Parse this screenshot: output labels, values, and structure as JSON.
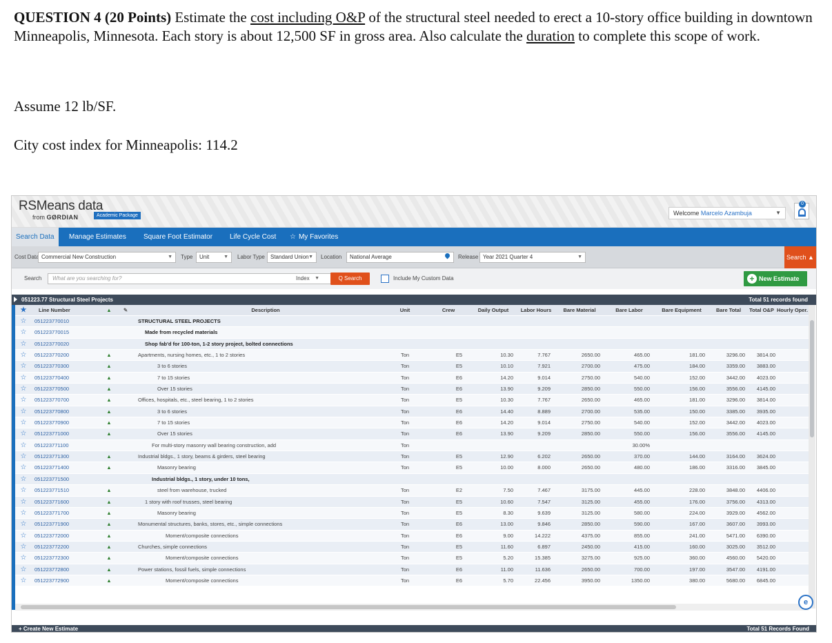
{
  "question": {
    "heading": "QUESTION 4 (20 Points)",
    "t1": " Estimate the ",
    "u1": "cost including O&P",
    "t2": " of the structural steel needed to erect a 10-story office building in downtown Minneapolis, Minnesota. Each story is about 12,500 SF in gross area. Also calculate the ",
    "u2": "duration",
    "t3": " to complete this scope of work.",
    "assume": "Assume 12 lb/SF.",
    "city_index": "City cost index for Minneapolis: 114.2"
  },
  "app": {
    "logo": "RSMeans data",
    "logo_from": "from",
    "logo_brand": "GØRDIAN",
    "package_badge": "Academic Package",
    "welcome_prefix": "Welcome ",
    "user": "Marcelo Azambuja",
    "bell_count": "0",
    "nav": [
      "Search Data",
      "Manage Estimates",
      "Square Foot Estimator",
      "Life Cycle Cost",
      "My Favorites"
    ],
    "filters": {
      "cost_data_label": "Cost Data",
      "cost_data_value": "Commercial New Construction",
      "type_label": "Type",
      "type_value": "Unit",
      "labor_type_label": "Labor Type",
      "labor_type_value": "Standard Union",
      "location_label": "Location",
      "location_value": "National Average",
      "release_label": "Release",
      "release_value": "Year 2021 Quarter 4",
      "search_toggle": "Search ▲"
    },
    "search": {
      "label": "Search",
      "placeholder": "What are you searching for?",
      "index_label": "Index",
      "button": "Q Search",
      "custom_data_label": "Include My Custom Data",
      "new_estimate": "New Estimate"
    },
    "group": {
      "title": "051223.77 Structural Steel Projects",
      "count": "Total 51 records found"
    },
    "columns": {
      "line": "Line Number",
      "desc": "Description",
      "unit": "Unit",
      "crew": "Crew",
      "daily_output": "Daily Output",
      "labor_hours": "Labor Hours",
      "bare_material": "Bare Material",
      "bare_labor": "Bare Labor",
      "bare_equipment": "Bare Equipment",
      "bare_total": "Bare Total",
      "total_op": "Total O&P",
      "hourly": "Hourly Oper. Co"
    },
    "footer": {
      "create": "+ Create New Estimate",
      "count": "Total 51 Records Found"
    }
  },
  "rows": [
    {
      "line": "051223770010",
      "desc": "STRUCTURAL STEEL PROJECTS",
      "bold": true,
      "indent": 0,
      "unit": "",
      "crew": "",
      "out": "",
      "lh": "",
      "bm": "",
      "bl": "",
      "be": "",
      "bt": "",
      "top": ""
    },
    {
      "line": "051223770015",
      "desc": "Made from recycled materials",
      "bold": true,
      "indent": 1,
      "unit": "",
      "crew": "",
      "out": "",
      "lh": "",
      "bm": "",
      "bl": "",
      "be": "",
      "bt": "",
      "top": ""
    },
    {
      "line": "051223770020",
      "desc": "Shop fab'd for 100-ton, 1-2 story project, bolted connections",
      "bold": true,
      "indent": 1,
      "unit": "",
      "crew": "",
      "out": "",
      "lh": "",
      "bm": "",
      "bl": "",
      "be": "",
      "bt": "",
      "top": ""
    },
    {
      "line": "051223770200",
      "desc": "Apartments, nursing homes, etc., 1 to 2 stories",
      "indent": 0,
      "unit": "Ton",
      "crew": "E5",
      "out": "10.30",
      "lh": "7.767",
      "bm": "2650.00",
      "bl": "465.00",
      "be": "181.00",
      "bt": "3296.00",
      "top": "3814.00",
      "ico": true
    },
    {
      "line": "051223770300",
      "desc": "3 to 6 stories",
      "indent": 3,
      "unit": "Ton",
      "crew": "E5",
      "out": "10.10",
      "lh": "7.921",
      "bm": "2700.00",
      "bl": "475.00",
      "be": "184.00",
      "bt": "3359.00",
      "top": "3883.00",
      "ico": true
    },
    {
      "line": "051223770400",
      "desc": "7 to 15 stories",
      "indent": 3,
      "unit": "Ton",
      "crew": "E6",
      "out": "14.20",
      "lh": "9.014",
      "bm": "2750.00",
      "bl": "540.00",
      "be": "152.00",
      "bt": "3442.00",
      "top": "4023.00",
      "ico": true
    },
    {
      "line": "051223770500",
      "desc": "Over 15 stories",
      "indent": 3,
      "unit": "Ton",
      "crew": "E6",
      "out": "13.90",
      "lh": "9.209",
      "bm": "2850.00",
      "bl": "550.00",
      "be": "156.00",
      "bt": "3556.00",
      "top": "4145.00",
      "ico": true
    },
    {
      "line": "051223770700",
      "desc": "Offices, hospitals, etc., steel bearing, 1 to 2 stories",
      "indent": 0,
      "unit": "Ton",
      "crew": "E5",
      "out": "10.30",
      "lh": "7.767",
      "bm": "2650.00",
      "bl": "465.00",
      "be": "181.00",
      "bt": "3296.00",
      "top": "3814.00",
      "ico": true
    },
    {
      "line": "051223770800",
      "desc": "3 to 6 stories",
      "indent": 3,
      "unit": "Ton",
      "crew": "E6",
      "out": "14.40",
      "lh": "8.889",
      "bm": "2700.00",
      "bl": "535.00",
      "be": "150.00",
      "bt": "3385.00",
      "top": "3935.00",
      "ico": true
    },
    {
      "line": "051223770900",
      "desc": "7 to 15 stories",
      "indent": 3,
      "unit": "Ton",
      "crew": "E6",
      "out": "14.20",
      "lh": "9.014",
      "bm": "2750.00",
      "bl": "540.00",
      "be": "152.00",
      "bt": "3442.00",
      "top": "4023.00",
      "ico": true
    },
    {
      "line": "051223771000",
      "desc": "Over 15 stories",
      "indent": 3,
      "unit": "Ton",
      "crew": "E6",
      "out": "13.90",
      "lh": "9.209",
      "bm": "2850.00",
      "bl": "550.00",
      "be": "156.00",
      "bt": "3556.00",
      "top": "4145.00",
      "ico": true
    },
    {
      "line": "051223771100",
      "desc": "For multi-story masonry wall bearing construction, add",
      "indent": 2,
      "unit": "Ton",
      "crew": "",
      "out": "",
      "lh": "",
      "bm": "",
      "bl": "30.00%",
      "be": "",
      "bt": "",
      "top": ""
    },
    {
      "line": "051223771300",
      "desc": "Industrial bldgs., 1 story, beams & girders, steel bearing",
      "indent": 0,
      "unit": "Ton",
      "crew": "E5",
      "out": "12.90",
      "lh": "6.202",
      "bm": "2650.00",
      "bl": "370.00",
      "be": "144.00",
      "bt": "3164.00",
      "top": "3624.00",
      "ico": true
    },
    {
      "line": "051223771400",
      "desc": "Masonry bearing",
      "indent": 3,
      "unit": "Ton",
      "crew": "E5",
      "out": "10.00",
      "lh": "8.000",
      "bm": "2650.00",
      "bl": "480.00",
      "be": "186.00",
      "bt": "3316.00",
      "top": "3845.00",
      "ico": true
    },
    {
      "line": "051223771500",
      "desc": "Industrial bldgs., 1 story, under 10 tons,",
      "bold": true,
      "indent": 2,
      "unit": "",
      "crew": "",
      "out": "",
      "lh": "",
      "bm": "",
      "bl": "",
      "be": "",
      "bt": "",
      "top": ""
    },
    {
      "line": "051223771510",
      "desc": "steel from warehouse, trucked",
      "indent": 3,
      "unit": "Ton",
      "crew": "E2",
      "out": "7.50",
      "lh": "7.467",
      "bm": "3175.00",
      "bl": "445.00",
      "be": "228.00",
      "bt": "3848.00",
      "top": "4406.00",
      "ico": true
    },
    {
      "line": "051223771600",
      "desc": "1 story with roof trusses, steel bearing",
      "indent": 1,
      "unit": "Ton",
      "crew": "E5",
      "out": "10.60",
      "lh": "7.547",
      "bm": "3125.00",
      "bl": "455.00",
      "be": "176.00",
      "bt": "3756.00",
      "top": "4313.00",
      "ico": true
    },
    {
      "line": "051223771700",
      "desc": "Masonry bearing",
      "indent": 3,
      "unit": "Ton",
      "crew": "E5",
      "out": "8.30",
      "lh": "9.639",
      "bm": "3125.00",
      "bl": "580.00",
      "be": "224.00",
      "bt": "3929.00",
      "top": "4562.00",
      "ico": true
    },
    {
      "line": "051223771900",
      "desc": "Monumental structures, banks, stores, etc., simple connections",
      "indent": 0,
      "unit": "Ton",
      "crew": "E6",
      "out": "13.00",
      "lh": "9.846",
      "bm": "2850.00",
      "bl": "590.00",
      "be": "167.00",
      "bt": "3607.00",
      "top": "3993.00",
      "ico": true
    },
    {
      "line": "051223772000",
      "desc": "Moment/composite connections",
      "indent": 4,
      "unit": "Ton",
      "crew": "E6",
      "out": "9.00",
      "lh": "14.222",
      "bm": "4375.00",
      "bl": "855.00",
      "be": "241.00",
      "bt": "5471.00",
      "top": "6390.00",
      "ico": true
    },
    {
      "line": "051223772200",
      "desc": "Churches, simple connections",
      "indent": 0,
      "unit": "Ton",
      "crew": "E5",
      "out": "11.60",
      "lh": "6.897",
      "bm": "2450.00",
      "bl": "415.00",
      "be": "160.00",
      "bt": "3025.00",
      "top": "3512.00",
      "ico": true
    },
    {
      "line": "051223772300",
      "desc": "Moment/composite connections",
      "indent": 4,
      "unit": "Ton",
      "crew": "E5",
      "out": "5.20",
      "lh": "15.385",
      "bm": "3275.00",
      "bl": "925.00",
      "be": "360.00",
      "bt": "4560.00",
      "top": "5420.00",
      "ico": true
    },
    {
      "line": "051223772800",
      "desc": "Power stations, fossil fuels, simple connections",
      "indent": 0,
      "unit": "Ton",
      "crew": "E6",
      "out": "11.00",
      "lh": "11.636",
      "bm": "2650.00",
      "bl": "700.00",
      "be": "197.00",
      "bt": "3547.00",
      "top": "4191.00",
      "ico": true
    },
    {
      "line": "051223772900",
      "desc": "Moment/composite connections",
      "indent": 4,
      "unit": "Ton",
      "crew": "E6",
      "out": "5.70",
      "lh": "22.456",
      "bm": "3950.00",
      "bl": "1350.00",
      "be": "380.00",
      "bt": "5680.00",
      "top": "6845.00",
      "ico": true
    }
  ]
}
